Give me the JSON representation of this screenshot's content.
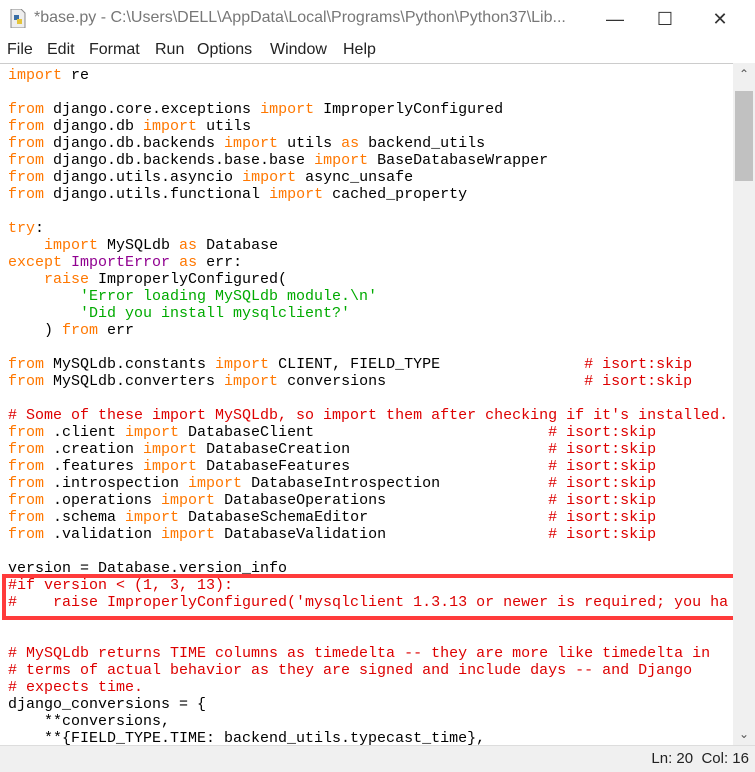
{
  "window": {
    "title": "*base.py - C:\\Users\\DELL\\AppData\\Local\\Programs\\Python\\Python37\\Lib...",
    "minimize": "—",
    "maximize": "☐",
    "close": "✕"
  },
  "menu": [
    "File",
    "Edit",
    "Format",
    "Run",
    "Options",
    "Window",
    "Help"
  ],
  "colors": {
    "keyword": "#ff7700",
    "string": "#00aa00",
    "comment": "#dd0000",
    "builtin": "#900090",
    "highlight_box": "#ff3b3b"
  },
  "code_lines": [
    [
      [
        "kw",
        "import"
      ],
      [
        "def",
        " re"
      ]
    ],
    [],
    [
      [
        "kw",
        "from"
      ],
      [
        "def",
        " django.core.exceptions "
      ],
      [
        "kw",
        "import"
      ],
      [
        "def",
        " ImproperlyConfigured"
      ]
    ],
    [
      [
        "kw",
        "from"
      ],
      [
        "def",
        " django.db "
      ],
      [
        "kw",
        "import"
      ],
      [
        "def",
        " utils"
      ]
    ],
    [
      [
        "kw",
        "from"
      ],
      [
        "def",
        " django.db.backends "
      ],
      [
        "kw",
        "import"
      ],
      [
        "def",
        " utils "
      ],
      [
        "kw",
        "as"
      ],
      [
        "def",
        " backend_utils"
      ]
    ],
    [
      [
        "kw",
        "from"
      ],
      [
        "def",
        " django.db.backends.base.base "
      ],
      [
        "kw",
        "import"
      ],
      [
        "def",
        " BaseDatabaseWrapper"
      ]
    ],
    [
      [
        "kw",
        "from"
      ],
      [
        "def",
        " django.utils.asyncio "
      ],
      [
        "kw",
        "import"
      ],
      [
        "def",
        " async_unsafe"
      ]
    ],
    [
      [
        "kw",
        "from"
      ],
      [
        "def",
        " django.utils.functional "
      ],
      [
        "kw",
        "import"
      ],
      [
        "def",
        " cached_property"
      ]
    ],
    [],
    [
      [
        "kw",
        "try"
      ],
      [
        "def",
        ":"
      ]
    ],
    [
      [
        "def",
        "    "
      ],
      [
        "kw",
        "import"
      ],
      [
        "def",
        " MySQLdb "
      ],
      [
        "kw",
        "as"
      ],
      [
        "def",
        " Database"
      ]
    ],
    [
      [
        "kw",
        "except"
      ],
      [
        "def",
        " "
      ],
      [
        "bi",
        "ImportError"
      ],
      [
        "def",
        " "
      ],
      [
        "kw",
        "as"
      ],
      [
        "def",
        " err:"
      ]
    ],
    [
      [
        "def",
        "    "
      ],
      [
        "kw",
        "raise"
      ],
      [
        "def",
        " ImproperlyConfigured("
      ]
    ],
    [
      [
        "def",
        "        "
      ],
      [
        "str",
        "'Error loading MySQLdb module.\\n'"
      ]
    ],
    [
      [
        "def",
        "        "
      ],
      [
        "str",
        "'Did you install mysqlclient?'"
      ]
    ],
    [
      [
        "def",
        "    ) "
      ],
      [
        "kw",
        "from"
      ],
      [
        "def",
        " err"
      ]
    ],
    [],
    [
      [
        "kw",
        "from"
      ],
      [
        "def",
        " MySQLdb.constants "
      ],
      [
        "kw",
        "import"
      ],
      [
        "def",
        " CLIENT, FIELD_TYPE                "
      ],
      [
        "com",
        "# isort:skip"
      ]
    ],
    [
      [
        "kw",
        "from"
      ],
      [
        "def",
        " MySQLdb.converters "
      ],
      [
        "kw",
        "import"
      ],
      [
        "def",
        " conversions                      "
      ],
      [
        "com",
        "# isort:skip"
      ]
    ],
    [],
    [
      [
        "com",
        "# Some of these import MySQLdb, so import them after checking if it's installed."
      ]
    ],
    [
      [
        "kw",
        "from"
      ],
      [
        "def",
        " .client "
      ],
      [
        "kw",
        "import"
      ],
      [
        "def",
        " DatabaseClient                          "
      ],
      [
        "com",
        "# isort:skip"
      ]
    ],
    [
      [
        "kw",
        "from"
      ],
      [
        "def",
        " .creation "
      ],
      [
        "kw",
        "import"
      ],
      [
        "def",
        " DatabaseCreation                      "
      ],
      [
        "com",
        "# isort:skip"
      ]
    ],
    [
      [
        "kw",
        "from"
      ],
      [
        "def",
        " .features "
      ],
      [
        "kw",
        "import"
      ],
      [
        "def",
        " DatabaseFeatures                      "
      ],
      [
        "com",
        "# isort:skip"
      ]
    ],
    [
      [
        "kw",
        "from"
      ],
      [
        "def",
        " .introspection "
      ],
      [
        "kw",
        "import"
      ],
      [
        "def",
        " DatabaseIntrospection            "
      ],
      [
        "com",
        "# isort:skip"
      ]
    ],
    [
      [
        "kw",
        "from"
      ],
      [
        "def",
        " .operations "
      ],
      [
        "kw",
        "import"
      ],
      [
        "def",
        " DatabaseOperations                  "
      ],
      [
        "com",
        "# isort:skip"
      ]
    ],
    [
      [
        "kw",
        "from"
      ],
      [
        "def",
        " .schema "
      ],
      [
        "kw",
        "import"
      ],
      [
        "def",
        " DatabaseSchemaEditor                    "
      ],
      [
        "com",
        "# isort:skip"
      ]
    ],
    [
      [
        "kw",
        "from"
      ],
      [
        "def",
        " .validation "
      ],
      [
        "kw",
        "import"
      ],
      [
        "def",
        " DatabaseValidation                  "
      ],
      [
        "com",
        "# isort:skip"
      ]
    ],
    [],
    [
      [
        "def",
        "version = Database.version_info"
      ]
    ],
    [
      [
        "com",
        "#if version < (1, 3, 13):"
      ]
    ],
    [
      [
        "com",
        "#    raise ImproperlyConfigured('mysqlclient 1.3.13 or newer is required; you ha"
      ]
    ],
    [],
    [],
    [
      [
        "com",
        "# MySQLdb returns TIME columns as timedelta -- they are more like timedelta in"
      ]
    ],
    [
      [
        "com",
        "# terms of actual behavior as they are signed and include days -- and Django"
      ]
    ],
    [
      [
        "com",
        "# expects time."
      ]
    ],
    [
      [
        "def",
        "django_conversions = {"
      ]
    ],
    [
      [
        "def",
        "    **conversions,"
      ]
    ],
    [
      [
        "def",
        "    **{FIELD_TYPE.TIME: backend_utils.typecast_time},"
      ]
    ]
  ],
  "status": {
    "line": "Ln: 20",
    "col": "Col: 16"
  },
  "scrollbar": {
    "up_icon": "chevron-up",
    "down_icon": "chevron-down"
  }
}
